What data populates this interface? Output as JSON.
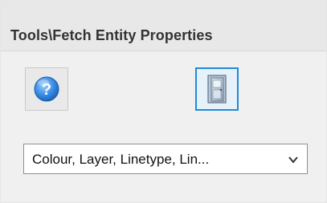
{
  "panel": {
    "title": "Tools\\Fetch Entity Properties"
  },
  "toolbar": {
    "help_icon": "help-question-icon",
    "door_icon": "door-exit-icon"
  },
  "properties_select": {
    "selected": "Colour, Layer, Linetype, Lin..."
  },
  "colors": {
    "accent": "#1f8ad6",
    "help_icon_blue": "#2d7ed6",
    "background": "#f0f0f0"
  }
}
